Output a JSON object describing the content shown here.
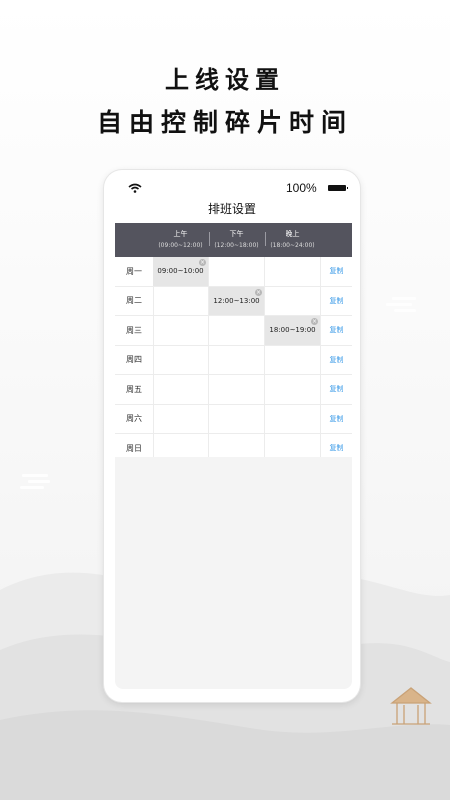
{
  "promo": {
    "title": "上线设置",
    "subtitle": "自由控制碎片时间"
  },
  "status_bar": {
    "battery": "100%"
  },
  "screen": {
    "title": "排班设置"
  },
  "columns": [
    {
      "name": "上午",
      "range": "(09:00~12:00)"
    },
    {
      "name": "下午",
      "range": "(12:00~18:00)"
    },
    {
      "name": "晚上",
      "range": "(18:00~24:00)"
    }
  ],
  "rows": [
    {
      "day": "周一",
      "slots": [
        "09:00~10:00",
        "",
        ""
      ],
      "copy": "复制"
    },
    {
      "day": "周二",
      "slots": [
        "",
        "12:00~13:00",
        ""
      ],
      "copy": "复制"
    },
    {
      "day": "周三",
      "slots": [
        "",
        "",
        "18:00~19:00"
      ],
      "copy": "复制"
    },
    {
      "day": "周四",
      "slots": [
        "",
        "",
        ""
      ],
      "copy": "复制"
    },
    {
      "day": "周五",
      "slots": [
        "",
        "",
        ""
      ],
      "copy": "复制"
    },
    {
      "day": "周六",
      "slots": [
        "",
        "",
        ""
      ],
      "copy": "复制"
    },
    {
      "day": "周日",
      "slots": [
        "",
        "",
        ""
      ],
      "copy": "复制"
    }
  ],
  "colors": {
    "header_bg": "#54545e",
    "copy_link": "#3b9be8",
    "slot_fill": "#e6e6e6"
  }
}
